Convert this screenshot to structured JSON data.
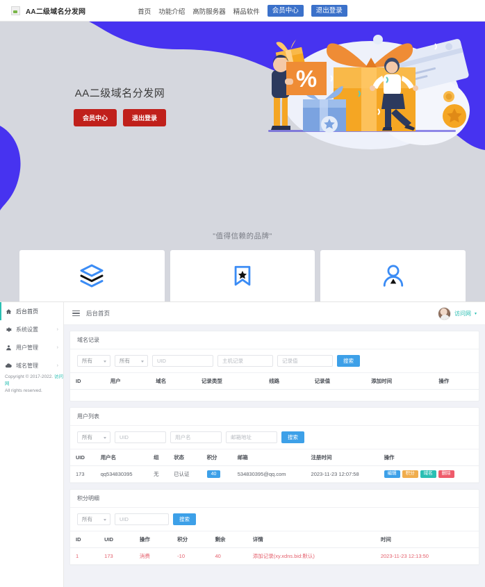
{
  "navbar": {
    "brand": "AA二级域名分发网",
    "links": [
      "首页",
      "功能介绍",
      "高防服务器",
      "精品软件"
    ],
    "buttons": [
      "会员中心",
      "退出登录"
    ]
  },
  "hero": {
    "title": "AA二级域名分发网",
    "buttons": [
      "会员中心",
      "退出登录"
    ],
    "bg_color": "#4733f0",
    "panel_color": "#d5d7de",
    "button_color": "#c0201b"
  },
  "tagline": "\"值得信赖的品牌\"",
  "cards": [
    {
      "icon": "layers-icon"
    },
    {
      "icon": "bookmark-star-icon"
    },
    {
      "icon": "user-icon"
    }
  ],
  "sidebar": {
    "items": [
      {
        "label": "后台首页",
        "icon": "home-icon",
        "arrow": "",
        "active": true
      },
      {
        "label": "系统设置",
        "icon": "gear-icon",
        "arrow": "›",
        "active": false
      },
      {
        "label": "用户管理",
        "icon": "user-icon",
        "arrow": "›",
        "active": false
      },
      {
        "label": "域名管理",
        "icon": "cloud-icon",
        "arrow": "›",
        "active": false
      }
    ],
    "copyright_line1": "Copyright © 2017-2022.",
    "copyright_link": "访问网",
    "copyright_line2": "All rights reserved."
  },
  "topbar": {
    "breadcrumb": "后台首页",
    "user_name": "访问网",
    "caret": "▾"
  },
  "domain_records": {
    "title": "域名记录",
    "filters": {
      "select1": "所有",
      "select2": "所有",
      "uid_placeholder": "UID",
      "host_placeholder": "主机记录",
      "value_placeholder": "记录值",
      "search_label": "搜索"
    },
    "columns": [
      "ID",
      "用户",
      "域名",
      "记录类型",
      "线路",
      "记录值",
      "添加时间",
      "操作"
    ],
    "rows": []
  },
  "user_list": {
    "title": "用户列表",
    "filters": {
      "select1": "所有",
      "uid_placeholder": "UID",
      "username_placeholder": "用户名",
      "email_placeholder": "邮箱地址",
      "search_label": "搜索"
    },
    "columns": [
      "UID",
      "用户名",
      "组",
      "状态",
      "积分",
      "邮箱",
      "注册时间",
      "操作"
    ],
    "rows": [
      {
        "uid": "173",
        "username": "qq534830395",
        "group": "无",
        "status": "已认证",
        "points": "40",
        "email": "534830395@qq.com",
        "reg_time": "2023-11-23 12:07:58",
        "actions": [
          "编辑",
          "积分",
          "域名",
          "删除"
        ]
      }
    ]
  },
  "points_detail": {
    "title": "积分明细",
    "filters": {
      "select1": "所有",
      "uid_placeholder": "UID",
      "search_label": "搜索"
    },
    "columns": [
      "ID",
      "UID",
      "操作",
      "积分",
      "剩余",
      "详情",
      "时间"
    ],
    "rows": [
      {
        "id": "1",
        "uid": "173",
        "action": "消费",
        "points": "-10",
        "remain": "40",
        "detail": "添加记录(xy.xdns.bid:默认)",
        "time": "2023-11-23 12:13:50"
      }
    ]
  }
}
